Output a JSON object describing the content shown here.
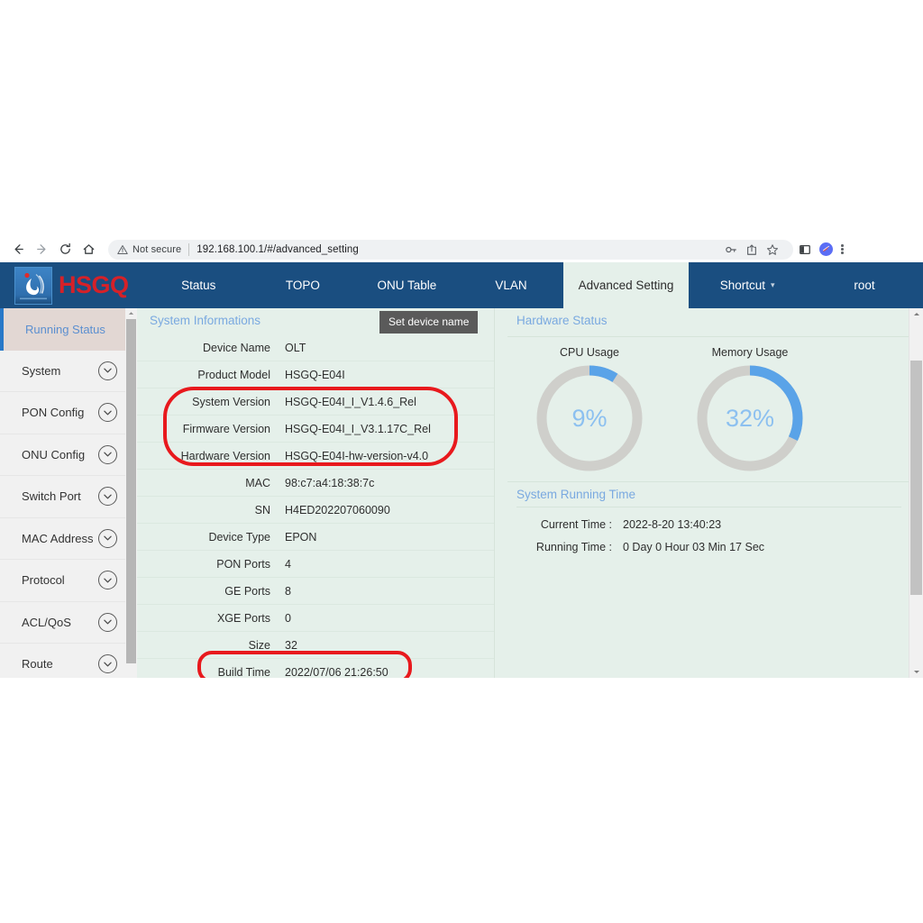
{
  "browser": {
    "back_icon": "back-arrow-icon",
    "forward_icon": "forward-arrow-icon",
    "reload_icon": "reload-icon",
    "home_icon": "home-icon",
    "security_label": "Not secure",
    "url": "192.168.100.1/#/advanced_setting",
    "toolbar_icons": [
      "key-icon",
      "share-icon",
      "star-icon",
      "sidepanel-icon",
      "profile-avatar-icon",
      "kebab-menu-icon"
    ]
  },
  "header": {
    "logo_text": "HSGQ",
    "tabs": [
      {
        "label": "Status",
        "active": false,
        "caret": false
      },
      {
        "label": "TOPO",
        "active": false,
        "caret": false
      },
      {
        "label": "ONU Table",
        "active": false,
        "caret": false
      },
      {
        "label": "VLAN",
        "active": false,
        "caret": false
      },
      {
        "label": "Advanced Setting",
        "active": true,
        "caret": false
      },
      {
        "label": "Shortcut",
        "active": false,
        "caret": true
      },
      {
        "label": "root",
        "active": false,
        "caret": false
      }
    ]
  },
  "sidebar": {
    "items": [
      {
        "label": "Running Status",
        "active": true,
        "expandable": false
      },
      {
        "label": "System",
        "active": false,
        "expandable": true
      },
      {
        "label": "PON Config",
        "active": false,
        "expandable": true
      },
      {
        "label": "ONU Config",
        "active": false,
        "expandable": true
      },
      {
        "label": "Switch Port",
        "active": false,
        "expandable": true
      },
      {
        "label": "MAC Address",
        "active": false,
        "expandable": true
      },
      {
        "label": "Protocol",
        "active": false,
        "expandable": true
      },
      {
        "label": "ACL/QoS",
        "active": false,
        "expandable": true
      },
      {
        "label": "Route",
        "active": false,
        "expandable": true
      }
    ]
  },
  "system_info": {
    "title": "System Informations",
    "set_device_name_button": "Set device name",
    "rows": [
      {
        "key": "Device Name",
        "value": "OLT"
      },
      {
        "key": "Product Model",
        "value": "HSGQ-E04I"
      },
      {
        "key": "System Version",
        "value": "HSGQ-E04I_I_V1.4.6_Rel"
      },
      {
        "key": "Firmware Version",
        "value": "HSGQ-E04I_I_V3.1.17C_Rel"
      },
      {
        "key": "Hardware Version",
        "value": "HSGQ-E04I-hw-version-v4.0"
      },
      {
        "key": "MAC",
        "value": "98:c7:a4:18:38:7c"
      },
      {
        "key": "SN",
        "value": "H4ED202207060090"
      },
      {
        "key": "Device Type",
        "value": "EPON"
      },
      {
        "key": "PON Ports",
        "value": "4"
      },
      {
        "key": "GE Ports",
        "value": "8"
      },
      {
        "key": "XGE Ports",
        "value": "0"
      },
      {
        "key": "Size",
        "value": "32"
      },
      {
        "key": "Build Time",
        "value": "2022/07/06 21:26:50"
      }
    ]
  },
  "hardware_status": {
    "title": "Hardware Status",
    "gauges": [
      {
        "label": "CPU Usage",
        "value": 9,
        "display": "9%"
      },
      {
        "label": "Memory Usage",
        "value": 32,
        "display": "32%"
      }
    ],
    "arc_color": "#5aa3e8",
    "track_color": "#cfcfcb"
  },
  "running_time": {
    "title": "System Running Time",
    "rows": [
      {
        "key": "Current Time :",
        "value": "2022-8-20 13:40:23"
      },
      {
        "key": "Running Time :",
        "value": "0 Day 0 Hour 03 Min 17 Sec"
      }
    ]
  },
  "annotations": [
    {
      "name": "versions-highlight",
      "color": "#e8191d"
    },
    {
      "name": "build-time-highlight",
      "color": "#e8191d"
    }
  ]
}
